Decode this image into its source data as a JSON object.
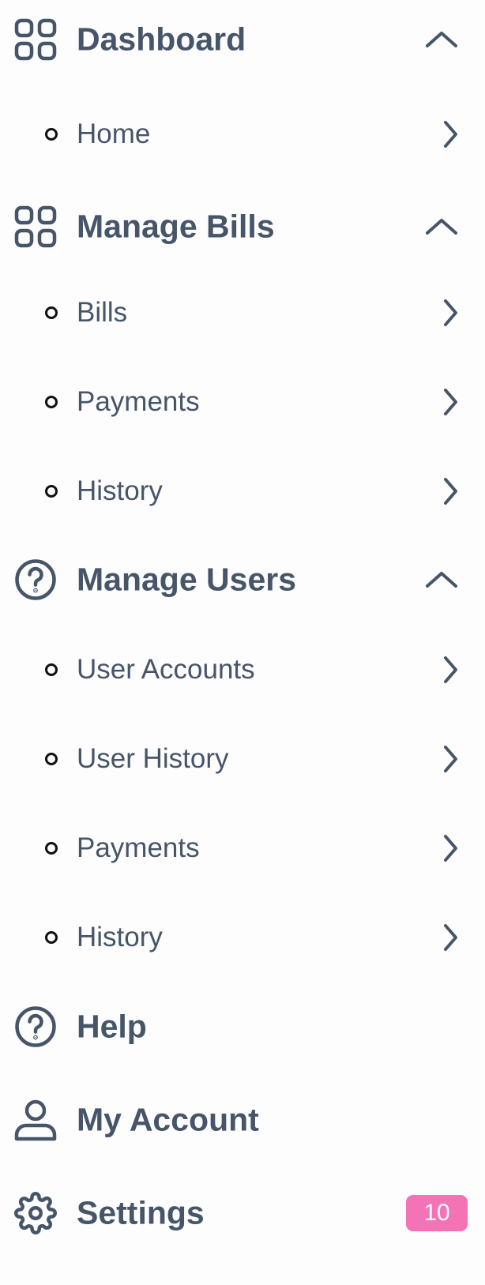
{
  "colors": {
    "text": "#475569",
    "bullet": "#111111",
    "badge": "#f472b6",
    "background": "#fdfdfe"
  },
  "sections": {
    "dashboard": {
      "label": "Dashboard",
      "icon": "grid-icon",
      "items": [
        {
          "label": "Home"
        }
      ]
    },
    "manage_bills": {
      "label": "Manage Bills",
      "icon": "grid-icon",
      "items": [
        {
          "label": "Bills"
        },
        {
          "label": "Payments"
        },
        {
          "label": "History"
        }
      ]
    },
    "manage_users": {
      "label": "Manage Users",
      "icon": "help-circle-icon",
      "items": [
        {
          "label": "User Accounts"
        },
        {
          "label": "User History"
        },
        {
          "label": "Payments"
        },
        {
          "label": "History"
        }
      ]
    }
  },
  "bottom": {
    "help": {
      "label": "Help",
      "icon": "help-circle-icon"
    },
    "my_account": {
      "label": "My Account",
      "icon": "user-icon"
    },
    "settings": {
      "label": "Settings",
      "icon": "gear-icon",
      "badge": "10"
    }
  }
}
